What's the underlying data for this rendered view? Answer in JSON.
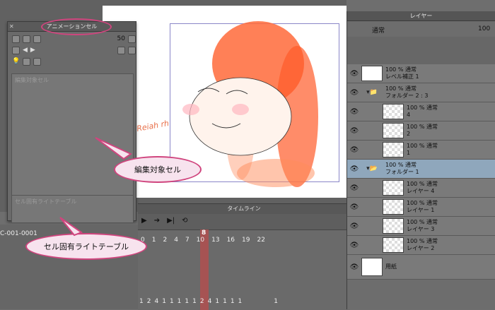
{
  "animation_panel": {
    "title": "アニメーションセル",
    "frame_value": "50",
    "cell_list_label": "編集対象セル",
    "light_table_label": "セル固有ライトテーブル"
  },
  "callouts": {
    "target_cell": "編集対象セル",
    "light_table": "セル固有ライトテーブル"
  },
  "timeline": {
    "title": "タイムライン",
    "track_name": "C-001-0001",
    "current_frame": "8",
    "ruler": [
      "0",
      "1",
      "2",
      "4",
      "7",
      "10",
      "13",
      "16",
      "19",
      "22"
    ],
    "cell_numbers": [
      "1",
      "2",
      "4",
      "1",
      "1",
      "1",
      "1",
      "1",
      "2",
      "4",
      "1",
      "1",
      "1",
      "1"
    ],
    "end_frame": "1"
  },
  "layers": {
    "title": "レイヤー",
    "blend_mode": "通常",
    "opacity": "100",
    "items": [
      {
        "line1": "100 % 通常",
        "line2": "レベル補正 1"
      },
      {
        "line1": "100 % 通常",
        "line2": "フォルダー 2 : 3"
      },
      {
        "line1": "100 % 通常",
        "line2": "4"
      },
      {
        "line1": "100 % 通常",
        "line2": "2"
      },
      {
        "line1": "100 % 通常",
        "line2": "1"
      },
      {
        "line1": "100 % 通常",
        "line2": "フォルダー 1"
      },
      {
        "line1": "100 % 通常",
        "line2": "レイヤー 4"
      },
      {
        "line1": "100 % 通常",
        "line2": "レイヤー 1"
      },
      {
        "line1": "100 % 通常",
        "line2": "レイヤー 3"
      },
      {
        "line1": "100 % 通常",
        "line2": "レイヤー 2"
      },
      {
        "line1": "",
        "line2": "用紙"
      }
    ]
  },
  "canvas": {
    "sketch_text": "Reiah rh"
  }
}
